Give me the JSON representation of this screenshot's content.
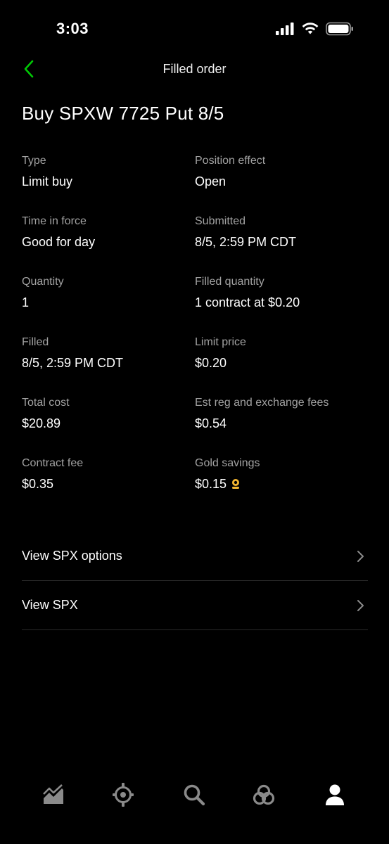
{
  "status_bar": {
    "time": "3:03"
  },
  "header": {
    "title": "Filled order",
    "back_icon": "chevron-left-icon",
    "accent_color": "#00c805"
  },
  "order": {
    "title": "Buy SPXW 7725 Put 8/5",
    "details": [
      [
        {
          "label": "Type",
          "value": "Limit buy"
        },
        {
          "label": "Position effect",
          "value": "Open"
        }
      ],
      [
        {
          "label": "Time in force",
          "value": "Good for day"
        },
        {
          "label": "Submitted",
          "value": "8/5, 2:59 PM CDT"
        }
      ],
      [
        {
          "label": "Quantity",
          "value": "1"
        },
        {
          "label": "Filled quantity",
          "value": "1 contract at $0.20"
        }
      ],
      [
        {
          "label": "Filled",
          "value": "8/5, 2:59 PM CDT"
        },
        {
          "label": "Limit price",
          "value": "$0.20"
        }
      ],
      [
        {
          "label": "Total cost",
          "value": "$20.89"
        },
        {
          "label": "Est reg and exchange fees",
          "value": "$0.54"
        }
      ],
      [
        {
          "label": "Contract fee",
          "value": "$0.35"
        },
        {
          "label": "Gold savings",
          "value": "$0.15"
        }
      ]
    ]
  },
  "links": [
    {
      "label": "View SPX options"
    },
    {
      "label": "View SPX"
    }
  ],
  "tab_bar": {
    "tabs": [
      {
        "icon": "chart-icon"
      },
      {
        "icon": "options-wheel-icon"
      },
      {
        "icon": "search-icon"
      },
      {
        "icon": "network-icon"
      },
      {
        "icon": "account-icon",
        "active": true
      }
    ]
  },
  "colors": {
    "background": "#000000",
    "label": "#a2a2a2",
    "gold": "#f5b731",
    "inactive_icon": "#8a8a8a"
  }
}
